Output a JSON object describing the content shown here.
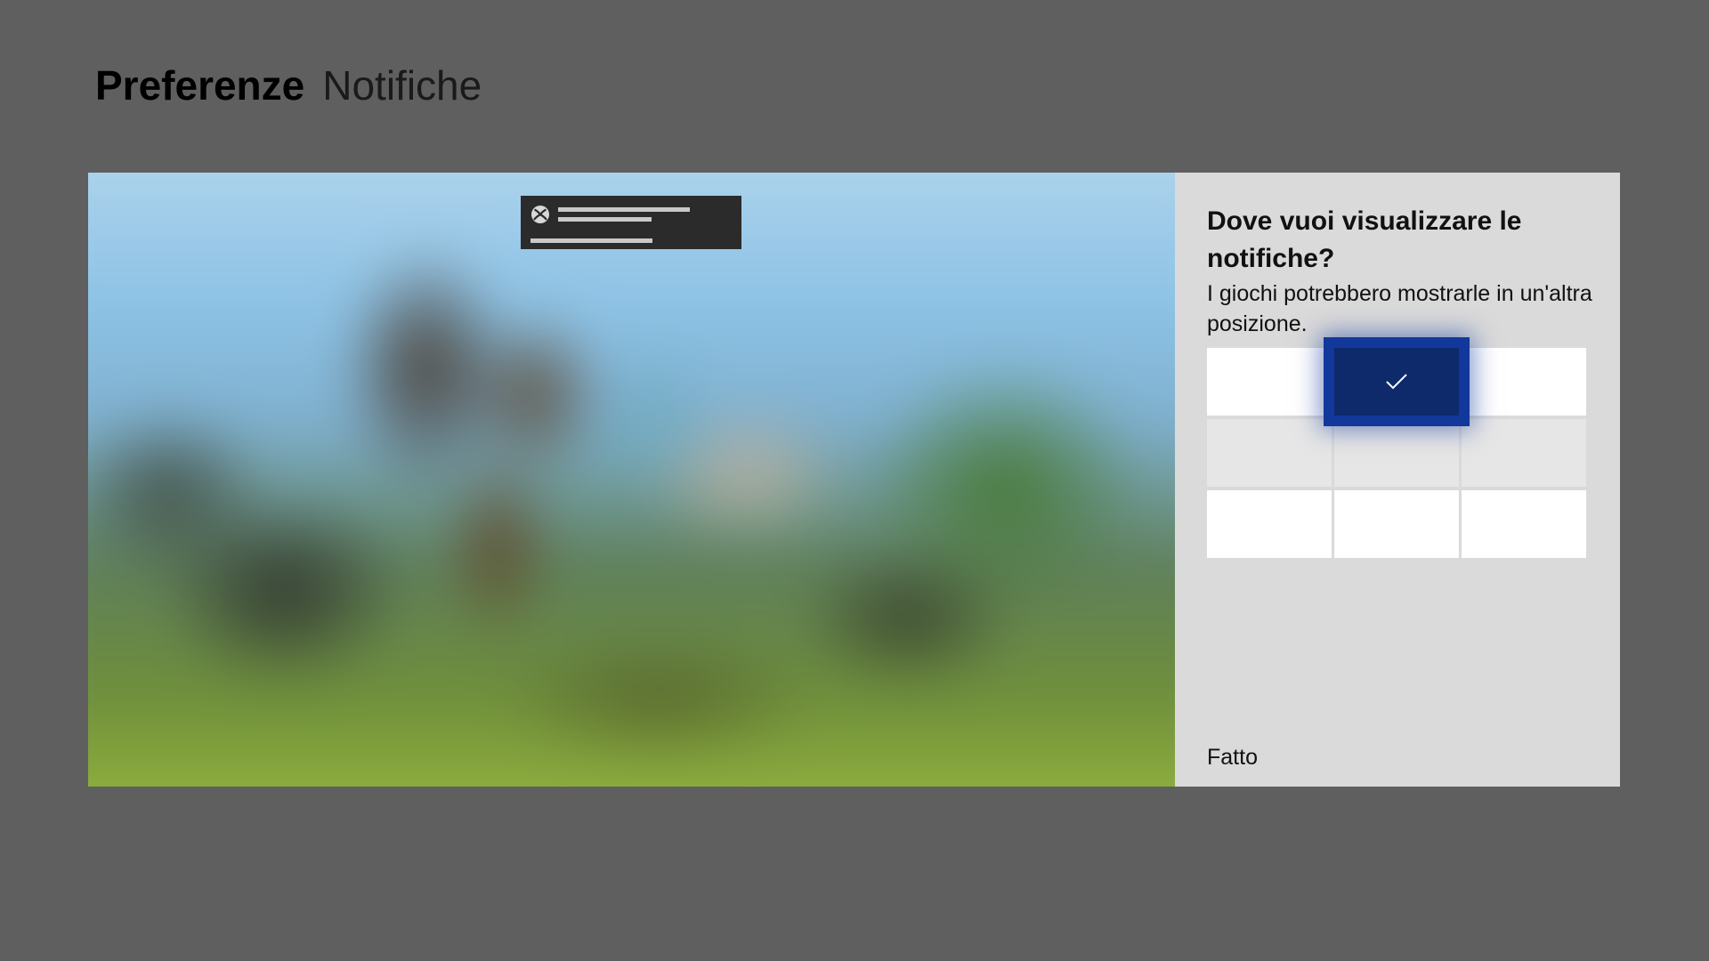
{
  "header": {
    "section": "Preferenze",
    "subsection": "Notifiche"
  },
  "options": {
    "title": "Dove vuoi visualizzare le notifiche?",
    "subtitle": "I giochi potrebbero mostrarle in un'altra posizione.",
    "done_label": "Fatto",
    "selected_position": "top-center"
  },
  "icons": {
    "toast": "xbox-logo-icon",
    "selected": "checkmark-icon"
  },
  "colors": {
    "selection_accent": "#13389b",
    "selection_fill": "#0e2a6b",
    "panel_background": "#dadada",
    "page_background": "#5f5f5f"
  }
}
